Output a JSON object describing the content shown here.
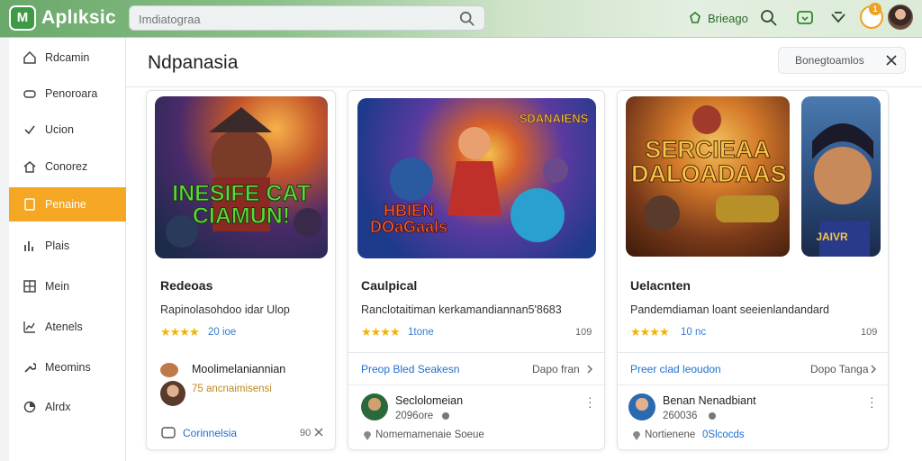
{
  "app": {
    "logo_text": "M",
    "brand": "Aplıksic"
  },
  "search": {
    "placeholder": "Imdiatograa"
  },
  "topbar": {
    "link_label": "Brieago"
  },
  "notifications": {
    "badge": "1"
  },
  "sidebar": {
    "items": [
      {
        "label": "Rdcamin",
        "icon": "home-icon"
      },
      {
        "label": "Penoroara",
        "icon": "gamepad-icon"
      },
      {
        "label": "Ucion",
        "icon": "check-icon"
      },
      {
        "label": "Conorez",
        "icon": "house-icon"
      },
      {
        "label": "Penaine",
        "icon": "document-icon",
        "active": true
      },
      {
        "label": "Plais",
        "icon": "chart-icon"
      },
      {
        "label": "Mein",
        "icon": "grid-icon"
      },
      {
        "label": "Atenels",
        "icon": "pulse-icon"
      },
      {
        "label": "Meomins",
        "icon": "wrench-icon"
      },
      {
        "label": "Alrdx",
        "icon": "pie-icon"
      }
    ]
  },
  "main": {
    "title": "Ndpanasia",
    "filter_label": "Bonegtoamlos"
  },
  "cards": [
    {
      "thumb_text": "INESIFE CAT\nCIAMUN!",
      "title": "Redeoas",
      "subtitle": "Rapinolasohdoo idar Ulop",
      "rating": "20 ioe",
      "count": "",
      "user_name": "Moolimelaniannian",
      "user_meta": "75 ancnaimisensi",
      "footer": "Corinnelsia",
      "footer_count": "90"
    },
    {
      "thumb_text": "HBIEN\nDOaGaals",
      "thumb_badge": "SDANAIENS",
      "title": "Caulpical",
      "subtitle": "Ranclotaitiman kerkamandiannan5'8683",
      "rating": "1tone",
      "count": "109",
      "link_left": "Preop Bled Seakesn",
      "link_right": "Dapo fran",
      "user_name": "Seclolomeian",
      "user_meta": "2096ore",
      "footer": "Nomemamenaie Soeue"
    },
    {
      "thumb_text": "SERCIEAA\nDALOADAAS",
      "thumb_badge": "JAIVR",
      "title": "Uelacnten",
      "subtitle": "Pandemdiaman loant seeienlandandard",
      "rating": "10 nc",
      "count": "109",
      "link_left": "Preer clad leoudon",
      "link_right": "Dopo Tanga",
      "user_name": "Benan Nenadbiant",
      "user_meta": "260036",
      "footer": "Nortienene",
      "footer_blue": "0Slcocds"
    }
  ],
  "colors": {
    "accent": "#f5a623",
    "brand_green": "#3f9a45",
    "link_blue": "#1f6fd1",
    "star": "#f5b301"
  }
}
